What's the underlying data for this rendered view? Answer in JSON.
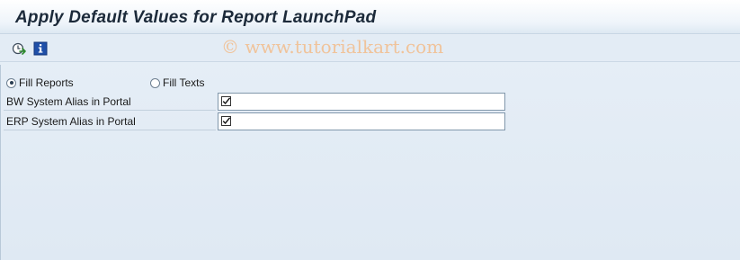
{
  "window": {
    "title": "Apply Default Values for Report LaunchPad"
  },
  "toolbar": {
    "buttons": [
      {
        "icon": "execute-icon"
      },
      {
        "icon": "information-icon"
      }
    ]
  },
  "watermark": "© www.tutorialkart.com",
  "options": {
    "radio_fill_reports": {
      "label": "Fill Reports",
      "selected": true
    },
    "radio_fill_texts": {
      "label": "Fill Texts",
      "selected": false
    }
  },
  "fields": [
    {
      "label": "BW System Alias in Portal",
      "value": "",
      "required_icon": "checkbox-required-icon"
    },
    {
      "label": "ERP System Alias in Portal",
      "value": "",
      "required_icon": "checkbox-required-icon"
    }
  ],
  "colors": {
    "background": "#dfe9f3",
    "title_text": "#1c2a3a",
    "watermark": "#f0c39a",
    "input_border": "#8197ab"
  }
}
